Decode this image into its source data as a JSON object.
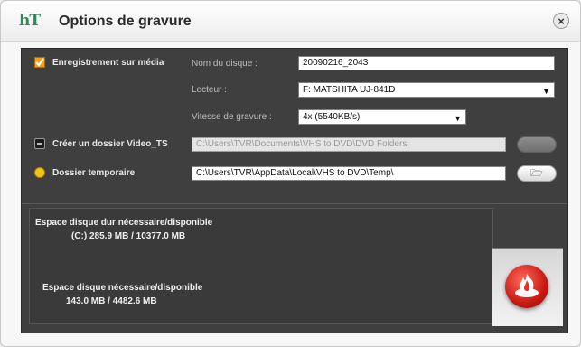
{
  "window": {
    "logo_text": "hT",
    "title": "Options de gravure",
    "close_glyph": "×"
  },
  "media": {
    "label": "Enregistrement sur média",
    "disc_name_label": "Nom du disque :",
    "disc_name_value": "20090216_2043",
    "drive_label": "Lecteur :",
    "drive_value": "F: MATSHITA UJ-841D",
    "speed_label": "Vitesse de gravure :",
    "speed_value": "4x (5540KB/s)"
  },
  "video_ts": {
    "label": "Créer un dossier Video_TS",
    "path": "C:\\Users\\TVR\\Documents\\VHS to DVD\\DVD Folders",
    "browse_glyph": ""
  },
  "temp": {
    "label": "Dossier temporaire",
    "path": "C:\\Users\\TVR\\AppData\\Local\\VHS to DVD\\Temp\\",
    "browse_glyph": "🗁"
  },
  "space": {
    "hdd_title": "Espace disque dur nécessaire/disponible",
    "hdd_value": "(C:)   285.9 MB / 10377.0 MB",
    "disc_title": "Espace disque nécessaire/disponible",
    "disc_value": "143.0 MB / 4482.6 MB"
  },
  "icons": {
    "media_checkbox": "checkbox-checked-icon",
    "video_ts_toggle": "disc-toggle-icon",
    "temp_folder": "folder-yellow-icon",
    "burn": "burn-flame-icon"
  },
  "colors": {
    "panel_bg": "#3f3f3f",
    "accent_orange": "#f2a31b",
    "burn_red": "#c81a14"
  }
}
